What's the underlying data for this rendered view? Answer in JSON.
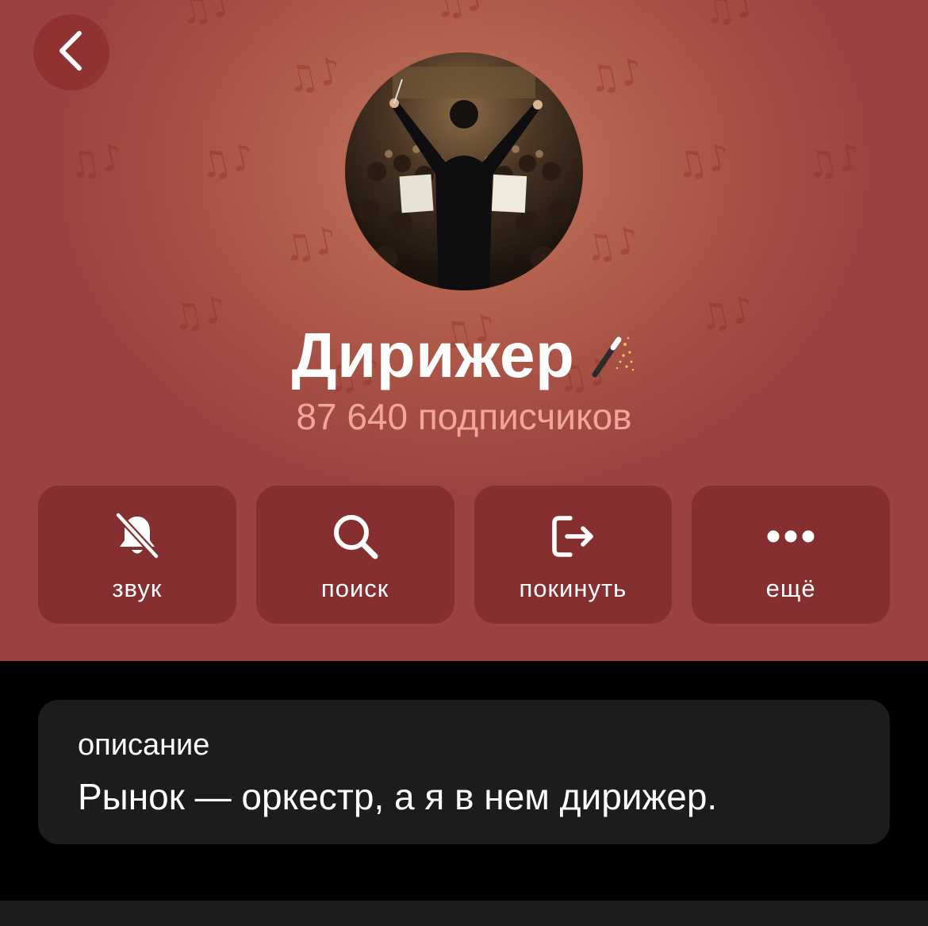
{
  "header": {
    "background_color": "#a44d44",
    "decoration_icon": "music-notes-icon",
    "back_icon": "chevron-left-icon"
  },
  "channel": {
    "avatar_icon": "orchestra-conductor-photo",
    "title": "Дирижер",
    "title_emoji_icon": "magic-wand-icon",
    "subscribers": "87 640 подписчиков"
  },
  "actions": [
    {
      "label": "звук",
      "icon": "bell-muted-icon"
    },
    {
      "label": "поиск",
      "icon": "search-icon"
    },
    {
      "label": "покинуть",
      "icon": "leave-icon"
    },
    {
      "label": "ещё",
      "icon": "more-icon"
    }
  ],
  "description": {
    "label": "описание",
    "text": "Рынок — оркестр, а я в нем дирижер."
  },
  "colors": {
    "action_bg": "#852f31",
    "subtitle": "#f0a79a",
    "card_bg": "#1c1c1e"
  }
}
